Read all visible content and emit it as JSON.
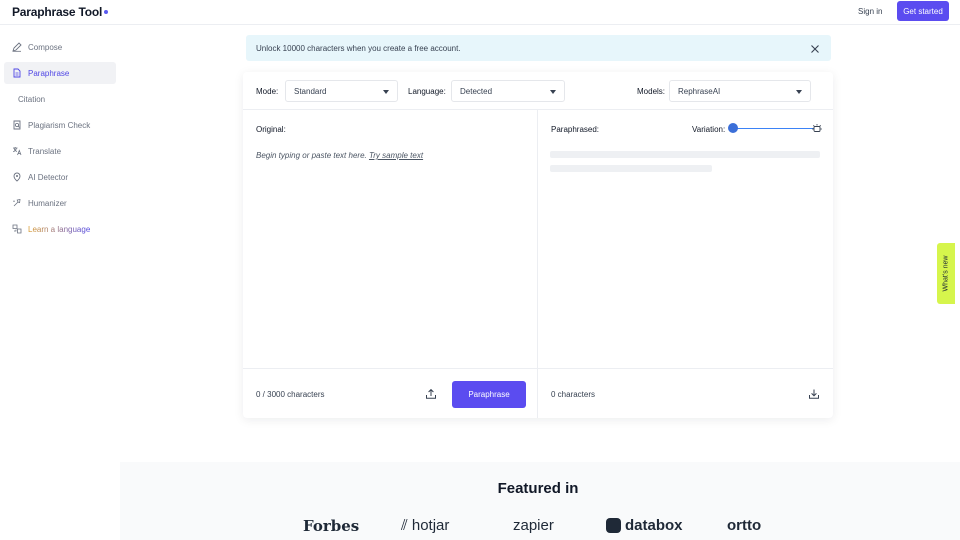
{
  "header": {
    "logo": "Paraphrase Tool",
    "sign_in": "Sign in",
    "get_started": "Get started",
    "accent_color": "#5b4cf0"
  },
  "sidebar": {
    "items": [
      {
        "label": "Compose",
        "icon": "pen-icon"
      },
      {
        "label": "Paraphrase",
        "icon": "document-icon",
        "active": true
      },
      {
        "label": "Citation",
        "icon": ""
      },
      {
        "label": "Plagiarism Check",
        "icon": "plagiarism-icon"
      },
      {
        "label": "Translate",
        "icon": "translate-icon"
      },
      {
        "label": "AI Detector",
        "icon": "ai-detector-icon"
      },
      {
        "label": "Humanizer",
        "icon": "humanizer-icon"
      },
      {
        "label": "Learn a language",
        "icon": "language-icon"
      }
    ]
  },
  "banner": {
    "text": "Unlock 10000 characters when you create a free account."
  },
  "controls": {
    "mode_label": "Mode:",
    "mode_value": "Standard",
    "language_label": "Language:",
    "language_value": "Detected",
    "models_label": "Models:",
    "models_value": "RephraseAI"
  },
  "original": {
    "title": "Original:",
    "placeholder": "Begin typing or paste text here.",
    "sample_link": "Try sample text",
    "count": "0 / 3000 characters",
    "button": "Paraphrase"
  },
  "paraphrased": {
    "title": "Paraphrased:",
    "variation_label": "Variation:",
    "variation_level": 0,
    "count": "0 characters"
  },
  "whats_new": "What's new",
  "featured": {
    "title": "Featured in",
    "brands": [
      "Forbes",
      "hotjar",
      "zapier",
      "databox",
      "ortto"
    ]
  }
}
